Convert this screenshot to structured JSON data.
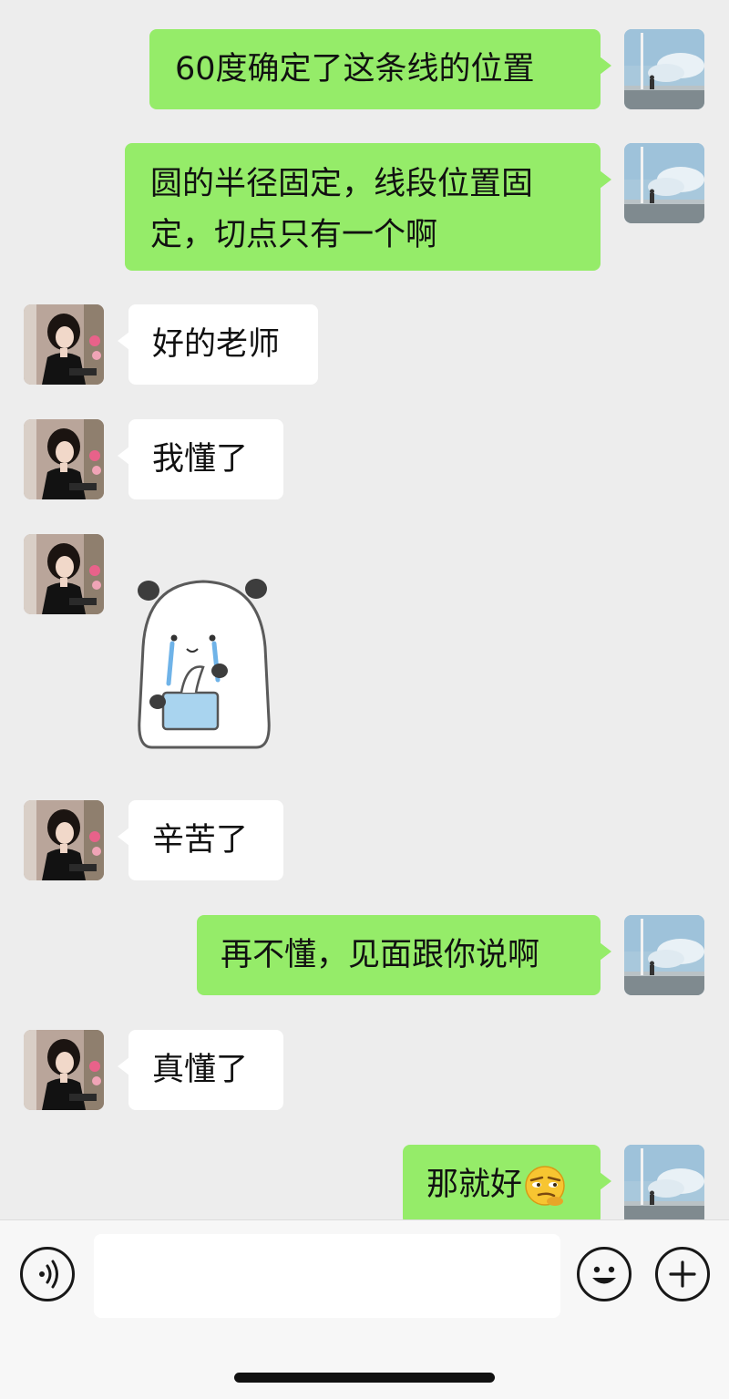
{
  "messages": [
    {
      "sender": "me",
      "text": "60度确定了这条线的位置"
    },
    {
      "sender": "me",
      "lines": [
        "圆的半径固定，线段位置固",
        "定，切点只有一个啊"
      ]
    },
    {
      "sender": "other",
      "text": "好的老师"
    },
    {
      "sender": "other",
      "text": "我懂了"
    },
    {
      "sender": "other",
      "sticker": "crying-panda-tissue-sticker"
    },
    {
      "sender": "other",
      "text": "辛苦了"
    },
    {
      "sender": "me",
      "text": "再不懂，见面跟你说啊"
    },
    {
      "sender": "other",
      "text": "真懂了"
    },
    {
      "sender": "me",
      "text": "那就好",
      "emoji": "smirk-emoji"
    }
  ],
  "input": {
    "value": "",
    "placeholder": ""
  },
  "toolbar": {
    "voice_icon": "voice-icon",
    "emoji_icon": "emoji-icon",
    "plus_icon": "plus-icon"
  },
  "colors": {
    "my_bubble": "#95ec69",
    "their_bubble": "#ffffff",
    "background": "#ededed"
  }
}
